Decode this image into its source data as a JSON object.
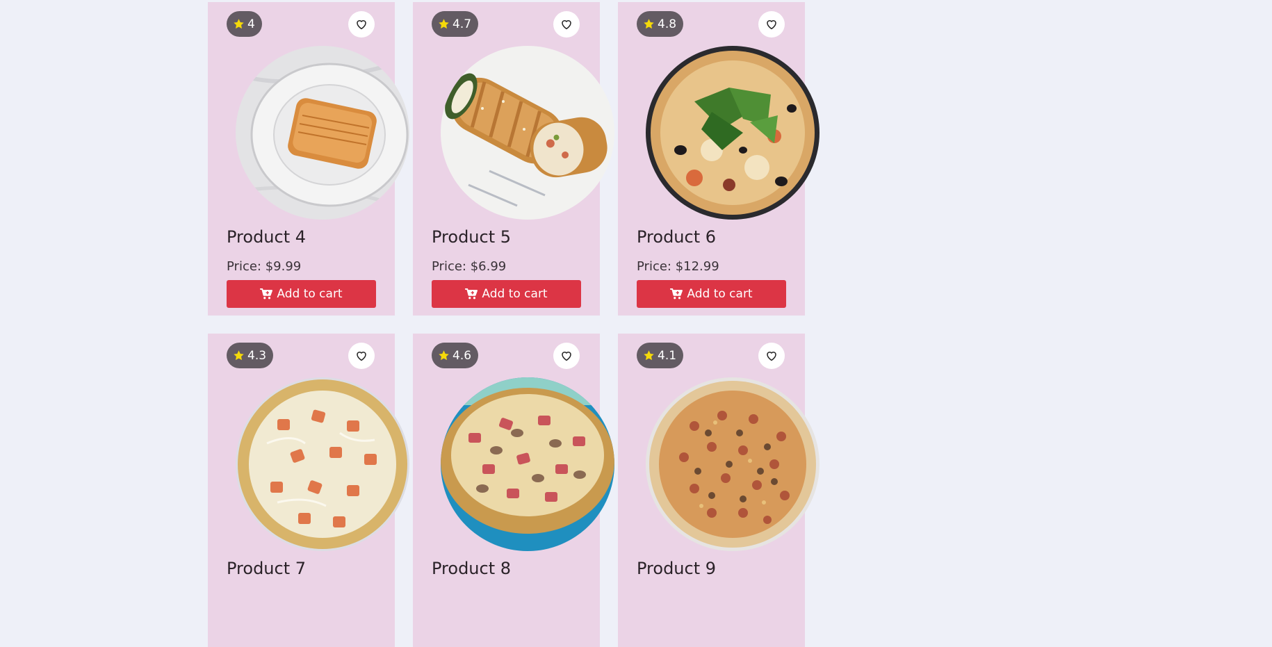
{
  "products": [
    {
      "rating": "4",
      "name": "Product 4",
      "price": "Price: $9.99",
      "cart_label": "Add to cart",
      "image": "pastry-photo"
    },
    {
      "rating": "4.7",
      "name": "Product 5",
      "price": "Price: $6.99",
      "cart_label": "Add to cart",
      "image": "stromboli-photo"
    },
    {
      "rating": "4.8",
      "name": "Product 6",
      "price": "Price: $12.99",
      "cart_label": "Add to cart",
      "image": "arugula-pizza-photo"
    },
    {
      "rating": "4.3",
      "name": "Product 7",
      "price": "",
      "cart_label": "",
      "image": "ham-cheese-pizza-photo"
    },
    {
      "rating": "4.6",
      "name": "Product 8",
      "price": "",
      "cart_label": "",
      "image": "ham-mushroom-pizza-photo"
    },
    {
      "rating": "4.1",
      "name": "Product 9",
      "price": "",
      "cart_label": "",
      "image": "meat-pizza-photo"
    }
  ],
  "icons": {
    "rating": "star-icon",
    "favorite": "heart-outline-icon",
    "cart": "cart-plus-icon"
  },
  "colors": {
    "page_background": "#eef0f8",
    "card_background": "#ebd3e6",
    "rating_badge": "#635b63",
    "star": "#f5d90a",
    "cart_button": "#dc3545"
  }
}
